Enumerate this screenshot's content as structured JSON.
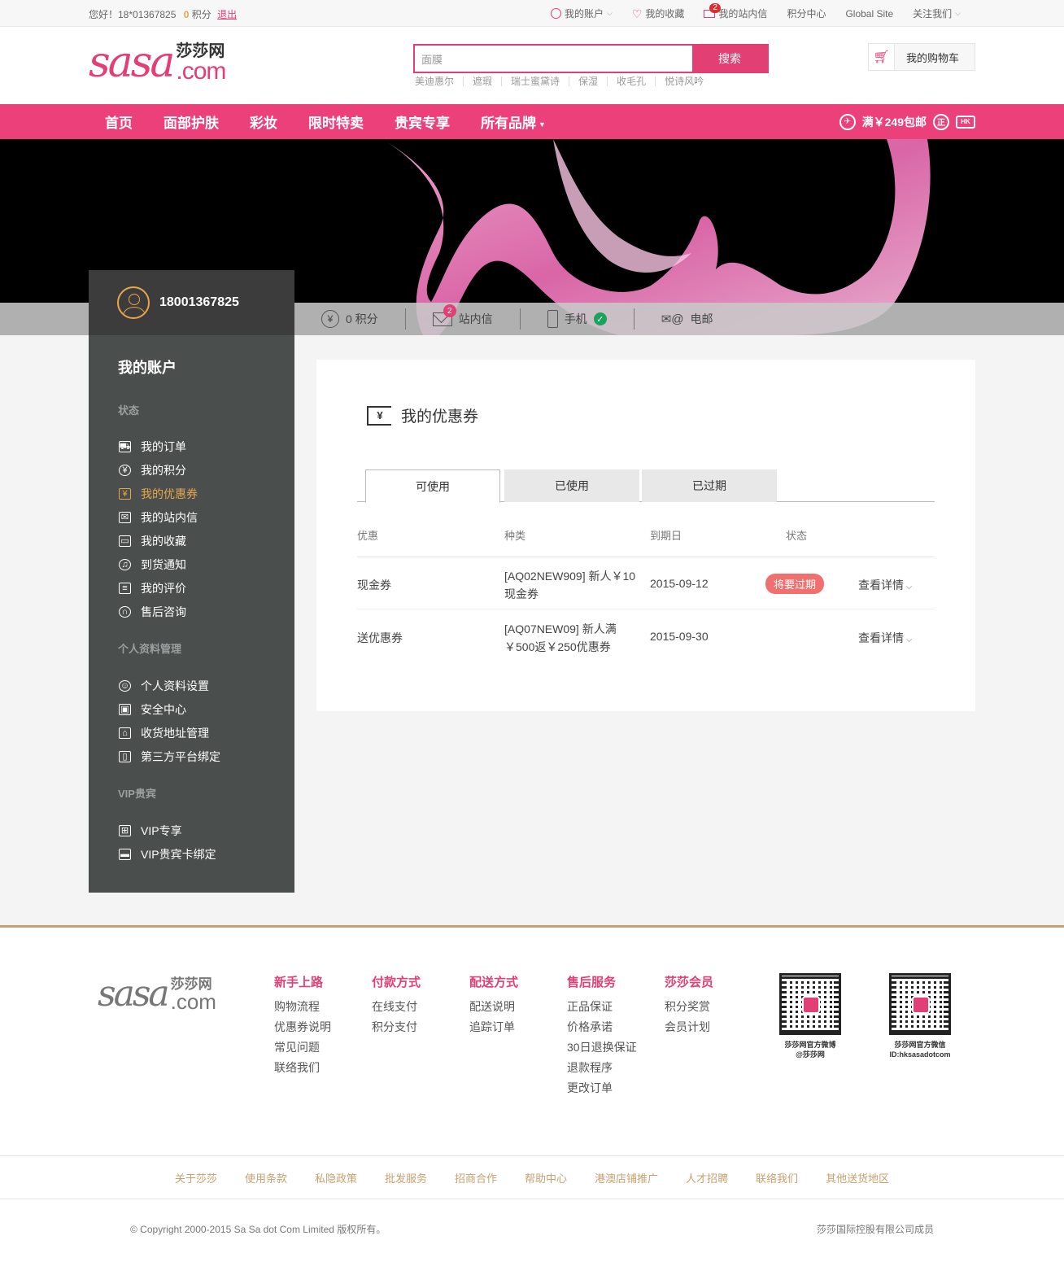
{
  "topbar": {
    "greeting": "您好！18*01367825",
    "points": "0",
    "points_label": "积分",
    "logout": "退出",
    "links": [
      {
        "label": "我的账户",
        "icon": "account-icon"
      },
      {
        "label": "我的收藏",
        "icon": "heart-icon"
      },
      {
        "label": "我的站内信",
        "icon": "mail-icon",
        "badge": "2"
      },
      {
        "label": "积分中心"
      },
      {
        "label": "Global Site"
      },
      {
        "label": "关注我们"
      }
    ]
  },
  "header": {
    "logo": {
      "brand": "sasa",
      "cn": "莎莎网",
      "com": ".com"
    },
    "search": {
      "value": "面膜",
      "button": "搜索"
    },
    "hotwords": [
      "美迪惠尔",
      "遮瑕",
      "瑞士蜜黛诗",
      "保湿",
      "收毛孔",
      "悦诗风吟"
    ],
    "cart": "我的购物车"
  },
  "nav": {
    "items": [
      "首页",
      "面部护肤",
      "彩妆",
      "限时特卖",
      "贵宾专享",
      "所有品牌"
    ],
    "promo": "满￥249包邮",
    "promo_icons": {
      "left": "✈",
      "mid": "正",
      "right": "HK"
    }
  },
  "user": {
    "phone": "18001367825"
  },
  "stats": [
    {
      "icon": "yen-icon",
      "label": "0 积分"
    },
    {
      "icon": "envelope-icon",
      "label": "站内信",
      "badge": "2"
    },
    {
      "icon": "phone-icon",
      "label": "手机"
    },
    {
      "icon": "email-icon",
      "label": "电邮"
    }
  ],
  "sidebar": {
    "title": "我的账户",
    "sections": [
      {
        "title": "状态",
        "items": [
          {
            "label": "我的订单",
            "icon": "cart-icon",
            "glyph": "⛟"
          },
          {
            "label": "我的积分",
            "icon": "yen-icon",
            "glyph": "¥"
          },
          {
            "label": "我的优惠券",
            "icon": "coupon-icon",
            "glyph": "¥",
            "active": true
          },
          {
            "label": "我的站内信",
            "icon": "mail-icon",
            "glyph": "✉"
          },
          {
            "label": "我的收藏",
            "icon": "box-icon",
            "glyph": "▭"
          },
          {
            "label": "到货通知",
            "icon": "bell-icon",
            "glyph": "♫"
          },
          {
            "label": "我的评价",
            "icon": "comment-icon",
            "glyph": "≡"
          },
          {
            "label": "售后咨询",
            "icon": "headset-icon",
            "glyph": "∩"
          }
        ]
      },
      {
        "title": "个人资料管理",
        "items": [
          {
            "label": "个人资料设置",
            "icon": "person-icon",
            "glyph": "☺"
          },
          {
            "label": "安全中心",
            "icon": "lock-icon",
            "glyph": "▣"
          },
          {
            "label": "收货地址管理",
            "icon": "home-icon",
            "glyph": "⌂"
          },
          {
            "label": "第三方平台绑定",
            "icon": "mobile-icon",
            "glyph": "▯"
          }
        ]
      },
      {
        "title": "VIP贵宾",
        "items": [
          {
            "label": "VIP专享",
            "icon": "gift-icon",
            "glyph": "⊞"
          },
          {
            "label": "VIP贵宾卡绑定",
            "icon": "card-icon",
            "glyph": "▬"
          }
        ]
      }
    ]
  },
  "content": {
    "title": "我的优惠券",
    "title_icon": "¥",
    "tabs": [
      "可使用",
      "已使用",
      "已过期"
    ],
    "columns": [
      "优惠",
      "种类",
      "到期日",
      "状态"
    ],
    "rows": [
      {
        "type": "现金券",
        "kind_line1": "[AQ02NEW909] 新人￥10",
        "kind_line2": "现金券",
        "expiry": "2015-09-12",
        "status": "将要过期",
        "action": "查看详情"
      },
      {
        "type": "送优惠券",
        "kind_line1": "[AQ07NEW09] 新人满",
        "kind_line2": "￥500返￥250优惠券",
        "expiry": "2015-09-30",
        "status": "",
        "action": "查看详情"
      }
    ]
  },
  "footer": {
    "columns": [
      {
        "title": "新手上路",
        "links": [
          "购物流程",
          "优惠券说明",
          "常见问题",
          "联络我们"
        ]
      },
      {
        "title": "付款方式",
        "links": [
          "在线支付",
          "积分支付"
        ]
      },
      {
        "title": "配送方式",
        "links": [
          "配送说明",
          "追踪订单"
        ]
      },
      {
        "title": "售后服务",
        "links": [
          "正品保证",
          "价格承诺",
          "30日退换保证",
          "退款程序",
          "更改订单"
        ]
      },
      {
        "title": "莎莎会员",
        "links": [
          "积分奖赏",
          "会员计划"
        ]
      }
    ],
    "qr": [
      {
        "line1": "莎莎网官方微博",
        "line2": "@莎莎网"
      },
      {
        "line1": "莎莎网官方微信",
        "line2": "ID:hksasadotcom"
      }
    ],
    "links": [
      "关于莎莎",
      "使用条款",
      "私隐政策",
      "批发服务",
      "招商合作",
      "帮助中心",
      "港澳店铺推广",
      "人才招聘",
      "联络我们",
      "其他送货地区"
    ],
    "copyright": "© Copyright 2000-2015 Sa Sa dot Com Limited 版权所有。",
    "member": "莎莎国际控股有限公司成员"
  },
  "colors": {
    "accent": "#ec407a",
    "gold": "#c8a070",
    "sidebar": "#4a4f4e",
    "badge": "#f07070"
  }
}
